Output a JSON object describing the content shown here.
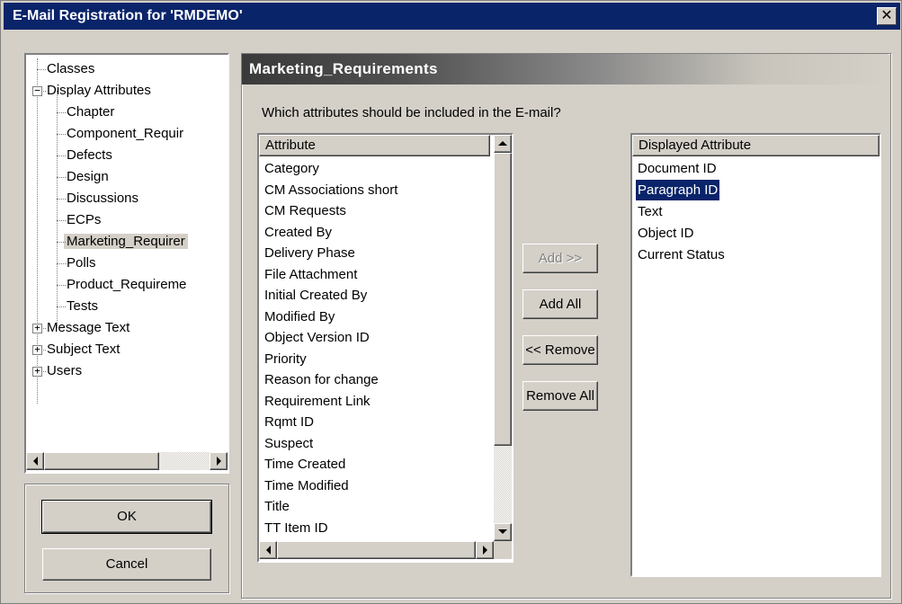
{
  "window": {
    "title": "E-Mail Registration for 'RMDEMO'",
    "close_glyph": "✕"
  },
  "tree": {
    "root_items": [
      {
        "label": "Classes",
        "expander": ""
      },
      {
        "label": "Display Attributes",
        "expander": "−"
      }
    ],
    "children": [
      {
        "label": "Chapter"
      },
      {
        "label": "Component_Requir"
      },
      {
        "label": "Defects"
      },
      {
        "label": "Design"
      },
      {
        "label": "Discussions"
      },
      {
        "label": "ECPs"
      },
      {
        "label": "Marketing_Requirer",
        "selected": true
      },
      {
        "label": "Polls"
      },
      {
        "label": "Product_Requireme"
      },
      {
        "label": "Tests"
      }
    ],
    "trailing_items": [
      {
        "label": "Message Text",
        "expander": "+"
      },
      {
        "label": "Subject Text",
        "expander": "+"
      },
      {
        "label": "Users",
        "expander": "+"
      }
    ]
  },
  "buttons": {
    "ok": "OK",
    "cancel": "Cancel",
    "add": "Add >>",
    "add_all": "Add All",
    "remove": "<< Remove",
    "remove_all": "Remove All"
  },
  "panel": {
    "header": "Marketing_Requirements",
    "question": "Which attributes should be included in the E-mail?"
  },
  "available": {
    "column_header": "Attribute",
    "items": [
      "Category",
      "CM Associations short",
      "CM Requests",
      "Created By",
      "Delivery Phase",
      "File Attachment",
      "Initial Created By",
      "Modified By",
      "Object Version ID",
      "Priority",
      "Reason for change",
      "Requirement Link",
      "Rqmt ID",
      "Suspect",
      "Time Created",
      "Time Modified",
      "Title",
      "TT Item ID"
    ]
  },
  "displayed": {
    "column_header": "Displayed Attribute",
    "items": [
      "Document ID",
      "Paragraph ID",
      "Text",
      "Object ID",
      "Current Status"
    ],
    "selected_item": "Paragraph ID"
  },
  "colors": {
    "titlebar": "#0a246a",
    "face": "#d4d0c8",
    "selection": "#0a246a"
  }
}
